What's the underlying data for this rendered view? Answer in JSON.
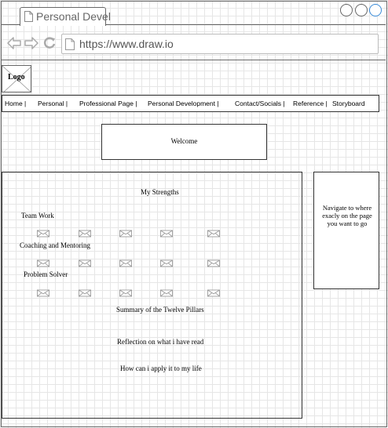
{
  "browser": {
    "tab_title": "Personal Devel",
    "url": "https://www.draw.io"
  },
  "logo": {
    "label": "Logo"
  },
  "navbar": {
    "items": [
      {
        "label": "Home |"
      },
      {
        "label": "Personal |"
      },
      {
        "label": "Professional Page |"
      },
      {
        "label": "Personal Development |"
      },
      {
        "label": "Contact/Socials |"
      },
      {
        "label": "Reference |"
      },
      {
        "label": "Storyboard"
      }
    ]
  },
  "welcome": {
    "text": "Welcome"
  },
  "main": {
    "heading": "My Strengths",
    "strengths": [
      {
        "label": "Team Work"
      },
      {
        "label": "Coaching and Mentoring"
      },
      {
        "label": "Problem Solver"
      }
    ],
    "summary": "Summary of the Twelve Pillars",
    "reflection": "Reflection on what i have read",
    "apply": "How can i apply it to my life"
  },
  "side_panel": {
    "text": "Navigate to where exacly on the page you want to go"
  },
  "icons": {
    "placeholder_image": "image-placeholder-icon",
    "document": "document-icon",
    "back": "back-arrow-icon",
    "forward": "forward-arrow-icon",
    "reload": "reload-icon"
  }
}
